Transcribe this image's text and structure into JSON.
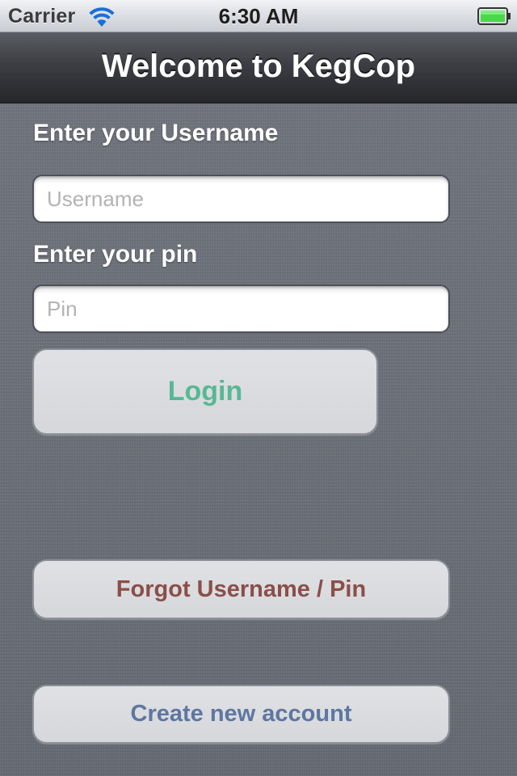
{
  "status_bar": {
    "carrier": "Carrier",
    "time": "6:30 AM",
    "battery_color": "#4cd64c"
  },
  "nav": {
    "title": "Welcome to KegCop"
  },
  "form": {
    "username_label": "Enter your Username",
    "username_placeholder": "Username",
    "username_value": "",
    "pin_label": "Enter your pin",
    "pin_placeholder": "Pin",
    "pin_value": ""
  },
  "buttons": {
    "login_label": "Login",
    "login_color": "#57b894",
    "forgot_label": "Forgot Username / Pin",
    "forgot_color": "#8a4f49",
    "create_label": "Create new account",
    "create_color": "#5d76a3"
  },
  "icons": {
    "wifi": "wifi-icon",
    "battery": "battery-icon"
  }
}
